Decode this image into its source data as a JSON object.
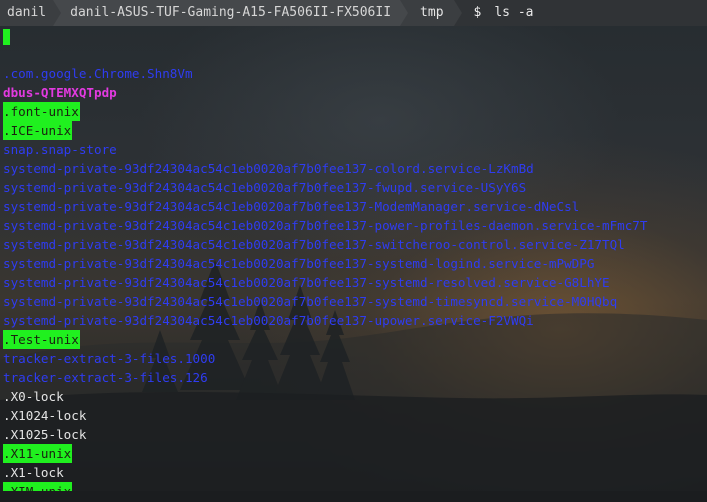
{
  "prompt": {
    "user": "danil",
    "host": "danil-ASUS-TUF-Gaming-A15-FA506II-FX506II",
    "directory": "tmp",
    "symbol": "$",
    "command": "ls -a"
  },
  "colors": {
    "highlight_green": "#20f01f",
    "directory_blue": "#2f3cf2",
    "pipe_magenta": "#e23ae0",
    "plain_text": "#e4e4e4",
    "prompt_bar": "#303336"
  },
  "listing": [
    {
      "name": ".",
      "style": "dot"
    },
    {
      "name": "",
      "style": "blank"
    },
    {
      "name": ".com.google.Chrome.Shn8Vm",
      "style": "dir"
    },
    {
      "name": "dbus-QTEMXQTpdp",
      "style": "pipe"
    },
    {
      "name": ".font-unix",
      "style": "hl"
    },
    {
      "name": ".ICE-unix",
      "style": "hl"
    },
    {
      "name": "snap.snap-store",
      "style": "dir"
    },
    {
      "name": "systemd-private-93df24304ac54c1eb0020af7b0fee137-colord.service-LzKmBd",
      "style": "dir"
    },
    {
      "name": "systemd-private-93df24304ac54c1eb0020af7b0fee137-fwupd.service-USyY6S",
      "style": "dir"
    },
    {
      "name": "systemd-private-93df24304ac54c1eb0020af7b0fee137-ModemManager.service-dNeCsl",
      "style": "dir"
    },
    {
      "name": "systemd-private-93df24304ac54c1eb0020af7b0fee137-power-profiles-daemon.service-mFmc7T",
      "style": "dir"
    },
    {
      "name": "systemd-private-93df24304ac54c1eb0020af7b0fee137-switcheroo-control.service-Z17TQl",
      "style": "dir"
    },
    {
      "name": "systemd-private-93df24304ac54c1eb0020af7b0fee137-systemd-logind.service-mPwDPG",
      "style": "dir"
    },
    {
      "name": "systemd-private-93df24304ac54c1eb0020af7b0fee137-systemd-resolved.service-G8LhYE",
      "style": "dir"
    },
    {
      "name": "systemd-private-93df24304ac54c1eb0020af7b0fee137-systemd-timesyncd.service-M0HQbq",
      "style": "dir"
    },
    {
      "name": "systemd-private-93df24304ac54c1eb0020af7b0fee137-upower.service-F2VWQi",
      "style": "dir"
    },
    {
      "name": ".Test-unix",
      "style": "hl"
    },
    {
      "name": "tracker-extract-3-files.1000",
      "style": "dir"
    },
    {
      "name": "tracker-extract-3-files.126",
      "style": "dir"
    },
    {
      "name": ".X0-lock",
      "style": "plain"
    },
    {
      "name": ".X1024-lock",
      "style": "plain"
    },
    {
      "name": ".X1025-lock",
      "style": "plain"
    },
    {
      "name": ".X11-unix",
      "style": "hl"
    },
    {
      "name": ".X1-lock",
      "style": "plain"
    },
    {
      "name": ".XIM-unix",
      "style": "hl"
    }
  ]
}
